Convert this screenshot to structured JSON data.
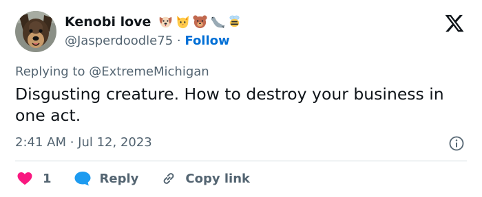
{
  "author": {
    "display_name": "Kenobi love",
    "handle": "@Jasperdoodle75",
    "separator": "·",
    "follow_label": "Follow",
    "name_emojis": [
      "dog-face",
      "cat-face",
      "bear-face",
      "seal",
      "bee"
    ]
  },
  "reply_context": {
    "prefix": "Replying to",
    "mention": "@ExtremeMichigan"
  },
  "tweet": {
    "text": "Disgusting creature. How to destroy your business in one act.",
    "timestamp": "2:41 AM · Jul 12, 2023"
  },
  "actions": {
    "like_count": "1",
    "reply_label": "Reply",
    "copy_link_label": "Copy link"
  },
  "colors": {
    "accent": "#006fd6",
    "like": "#f91880",
    "reply_icon": "#1d9bf0",
    "secondary_text": "#536471",
    "text": "#0f1419",
    "divider": "#cfd9de"
  }
}
